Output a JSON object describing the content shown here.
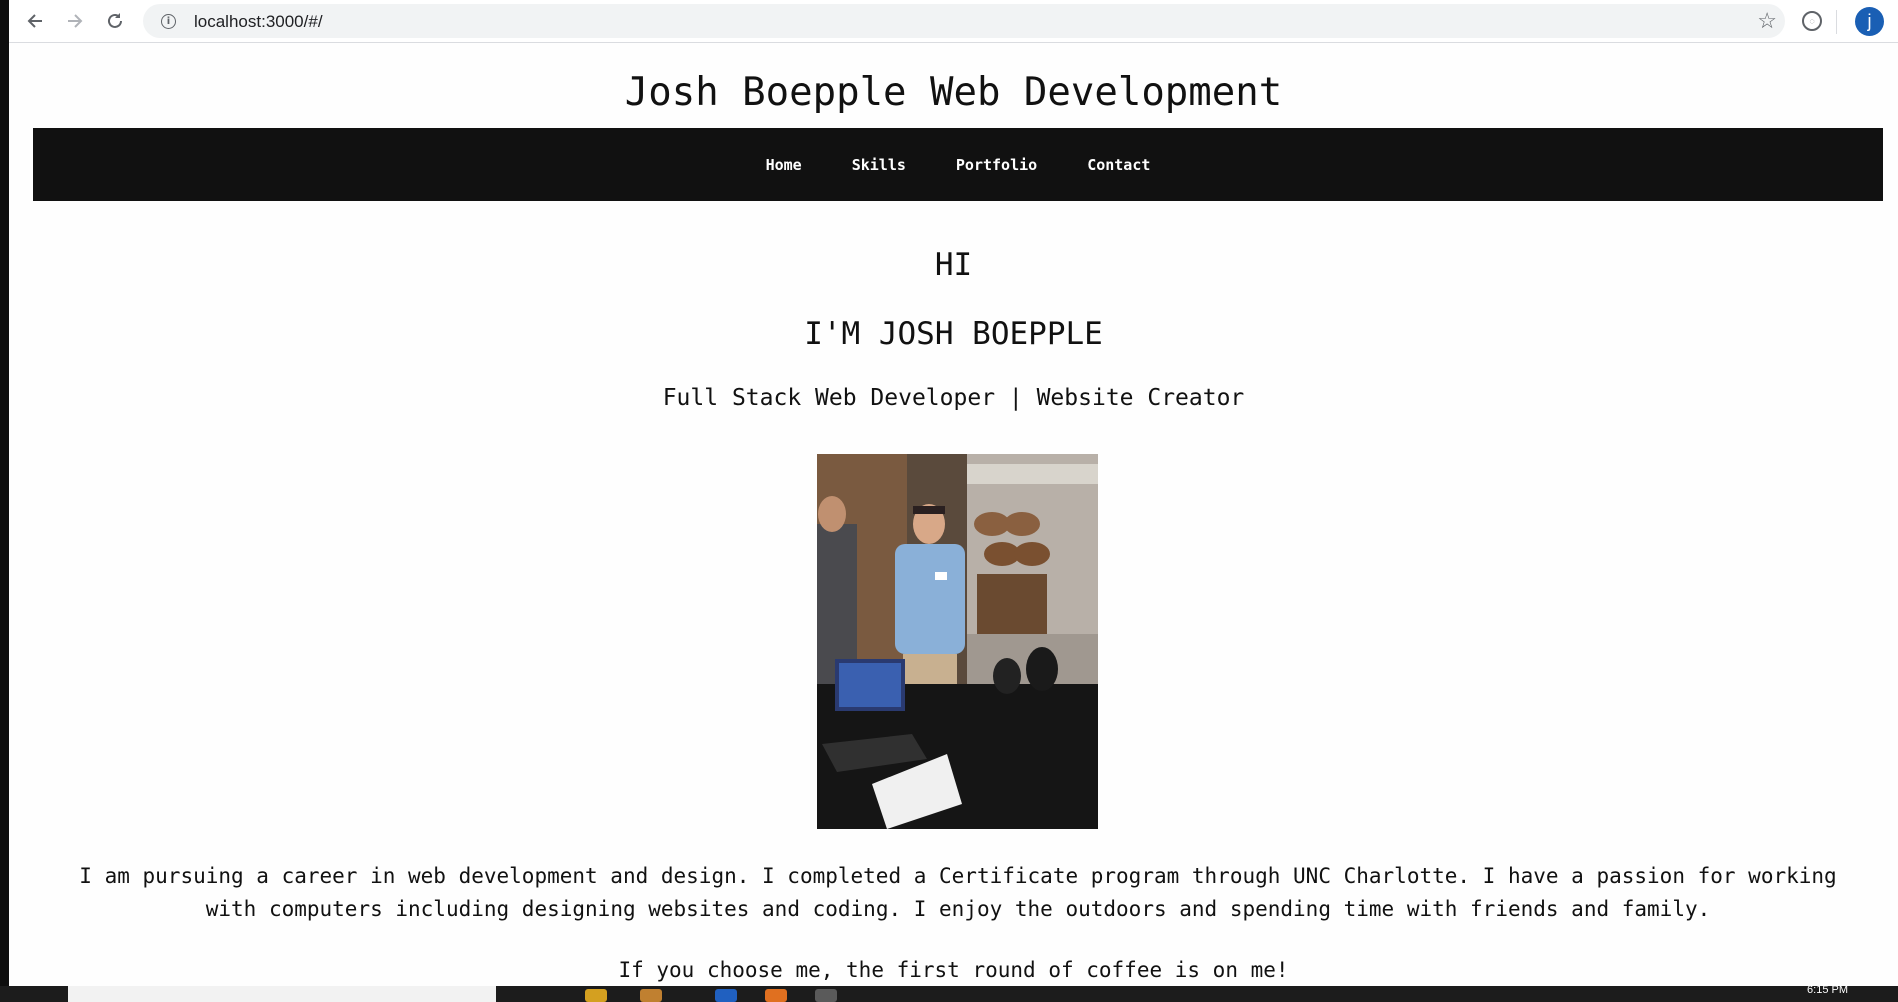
{
  "browser": {
    "url": "localhost:3000/#/",
    "avatar_letter": "j"
  },
  "site": {
    "title": "Josh Boepple Web Development",
    "nav": [
      "Home",
      "Skills",
      "Portfolio",
      "Contact"
    ],
    "greeting": "HI",
    "name_heading": "I'M JOSH BOEPPLE",
    "subtitle": "Full Stack Web Developer | Website Creator",
    "bio": "I am pursuing a career in web development and design. I completed a Certificate program through UNC Charlotte. I have a passion for working with computers including designing websites and coding. I enjoy the outdoors and spending time with friends and family.",
    "coffee_line": "If you choose me, the first round of coffee is on me!"
  },
  "taskbar": {
    "clock": "6:15 PM"
  },
  "colors": {
    "nav_background": "#111111",
    "page_background": "#fefefe",
    "avatar": "#1a5fb4"
  }
}
